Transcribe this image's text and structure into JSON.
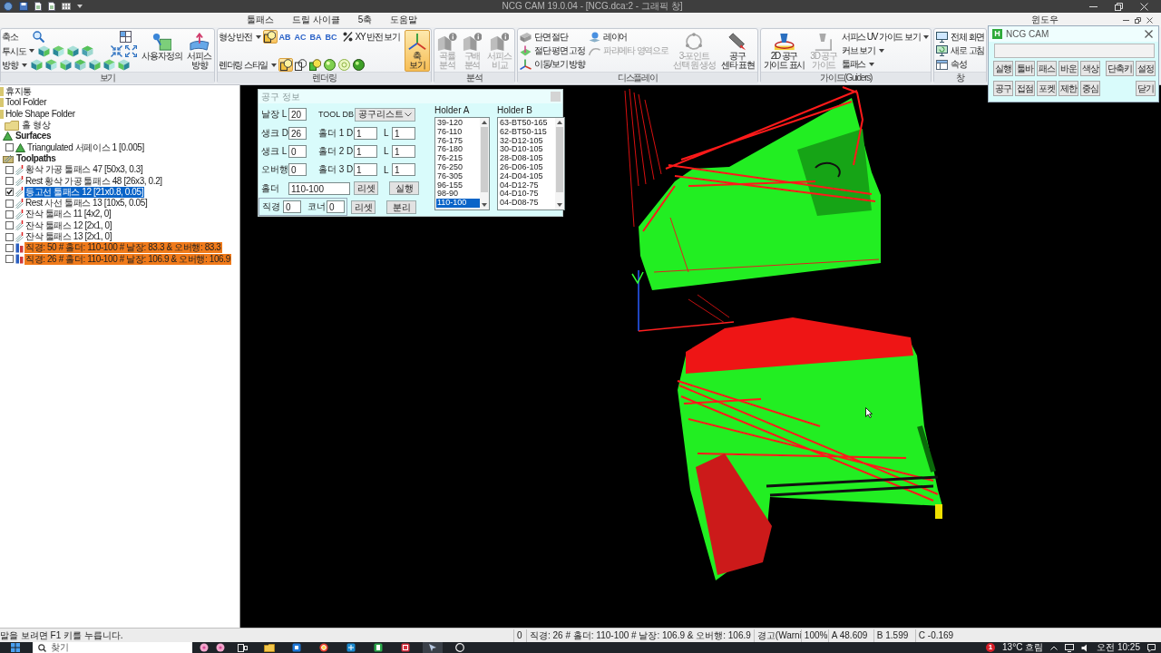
{
  "window": {
    "title": "NCG CAM 19.0.04 - [NCG.dca:2 - 그래픽 창]"
  },
  "menu_tabs": [
    {
      "label": "툴패스",
      "selected": false
    },
    {
      "label": "드릴 사이클",
      "selected": false
    },
    {
      "label": "5축",
      "selected": false
    },
    {
      "label": "도움말",
      "selected": false
    }
  ],
  "window_menu": {
    "label": "윈도우"
  },
  "ribbon": [
    {
      "title": "보기",
      "columns": [
        {
          "kind": "stack",
          "rows": [
            {
              "kind": "field",
              "label": "축소",
              "dropdown": false,
              "buttons": [
                {
                  "kind": "zoom",
                  "selected": false
                },
                {
                  "kind": "grid",
                  "selected": false
                }
              ]
            },
            {
              "kind": "field",
              "label": "투시도",
              "dropdown": true,
              "buttons": [
                {
                  "kind": "cube",
                  "selected": false
                },
                {
                  "kind": "cube",
                  "selected": false
                },
                {
                  "kind": "cube",
                  "selected": false
                },
                {
                  "kind": "cube",
                  "selected": false
                },
                {
                  "kind": "shrink",
                  "selected": false
                },
                {
                  "kind": "expand",
                  "selected": false
                }
              ]
            },
            {
              "kind": "field",
              "label": "방향",
              "dropdown": true,
              "buttons": [
                {
                  "kind": "cube",
                  "selected": false
                },
                {
                  "kind": "cube",
                  "selected": false
                },
                {
                  "kind": "cube",
                  "selected": false
                },
                {
                  "kind": "cube",
                  "selected": false
                },
                {
                  "kind": "cube",
                  "selected": false
                },
                {
                  "kind": "cube",
                  "selected": false
                },
                {
                  "kind": "cube",
                  "selected": false
                }
              ]
            }
          ]
        },
        {
          "kind": "large",
          "label": "사용자정의",
          "disabled": false,
          "on": false
        },
        {
          "kind": "large",
          "label": "서피스\n방향",
          "disabled": false,
          "on": false
        }
      ]
    },
    {
      "title": "렌더링",
      "columns": [
        {
          "kind": "stack",
          "rows": [
            {
              "kind": "field",
              "label": "형상 반전",
              "dropdown": true,
              "buttons": [
                {
                  "kind": "render",
                  "selected": true
                },
                {
                  "kind": "letters",
                  "label": "AB",
                  "selected": false
                },
                {
                  "kind": "letters",
                  "label": "AC",
                  "selected": false
                },
                {
                  "kind": "letters",
                  "label": "BA",
                  "selected": false
                },
                {
                  "kind": "letters",
                  "label": "BC",
                  "selected": false
                },
                {
                  "kind": "command",
                  "label": "XY 반전 보기",
                  "selected": false
                }
              ]
            },
            {
              "kind": "field",
              "label": "렌더링 스타일",
              "dropdown": true,
              "buttons": [
                {
                  "kind": "render",
                  "selected": true
                },
                {
                  "kind": "render",
                  "selected": false
                },
                {
                  "kind": "render",
                  "selected": false
                },
                {
                  "kind": "render",
                  "selected": false
                },
                {
                  "kind": "render",
                  "selected": false
                },
                {
                  "kind": "render",
                  "selected": false
                }
              ]
            }
          ]
        },
        {
          "kind": "large",
          "label": "축\n보기",
          "disabled": false,
          "on": true
        }
      ]
    },
    {
      "title": "분석",
      "columns": [
        {
          "kind": "large",
          "label": "곡률\n분석",
          "disabled": true,
          "on": false
        },
        {
          "kind": "large",
          "label": "구배\n분석",
          "disabled": true,
          "on": false
        },
        {
          "kind": "large",
          "label": "서피스\n비교",
          "disabled": true,
          "on": false
        }
      ]
    },
    {
      "title": "디스플레이",
      "columns": [
        {
          "kind": "stack",
          "rows": [
            {
              "kind": "command",
              "label": "단면 절단",
              "disabled": false
            },
            {
              "kind": "command",
              "label": "절단 평면 고정",
              "disabled": false
            },
            {
              "kind": "command",
              "label": "이동/보기 방향",
              "disabled": false
            }
          ]
        },
        {
          "kind": "stack",
          "rows": [
            {
              "kind": "command",
              "label": "레이어",
              "disabled": false
            },
            {
              "kind": "command",
              "label": "파라메타 영역으로",
              "disabled": true
            }
          ]
        },
        {
          "kind": "large",
          "label": "3-포인트\n선택 원 생성",
          "disabled": true,
          "on": false
        },
        {
          "kind": "large",
          "label": "공구\n센타 표현",
          "disabled": false,
          "on": false
        }
      ]
    },
    {
      "title": "가이드(Guiders)",
      "columns": [
        {
          "kind": "large",
          "label": "2D 공구\n가이드 표시",
          "disabled": false,
          "on": false
        },
        {
          "kind": "large",
          "label": "3D 공구\n가이드",
          "disabled": true,
          "on": false
        },
        {
          "kind": "stack",
          "rows": [
            {
              "kind": "menu",
              "label": "서피스 UV 가이드 보기"
            },
            {
              "kind": "menu",
              "label": "커브 보기"
            },
            {
              "kind": "menu",
              "label": "툴패스"
            }
          ]
        }
      ]
    },
    {
      "title": "창",
      "columns": [
        {
          "kind": "stack",
          "rows": [
            {
              "kind": "command",
              "label": "전체 화면",
              "disabled": false
            },
            {
              "kind": "command",
              "label": "새로 고침",
              "disabled": false
            },
            {
              "kind": "command",
              "label": "속성",
              "disabled": false
            }
          ]
        }
      ]
    }
  ],
  "command_panel": {
    "badge": "H",
    "title": "NCG CAM",
    "rows": [
      {
        "left": [
          "실행",
          "툴바",
          "패스",
          "바운",
          "색상"
        ],
        "right": [
          "단축키",
          "설정"
        ]
      },
      {
        "left": [
          "공구",
          "접점",
          "포켓",
          "제한",
          "중심"
        ],
        "right": [
          "닫기"
        ]
      }
    ]
  },
  "tree": [
    {
      "label": "휴지통",
      "kind": "folder"
    },
    {
      "label": "Tool Folder",
      "kind": "folder"
    },
    {
      "label": "Hole Shape Folder",
      "kind": "folder",
      "children": [
        {
          "label": "홀 형상",
          "kind": "folder"
        }
      ]
    },
    {
      "label": "Surfaces",
      "kind": "surface-group",
      "children": [
        {
          "label": "Triangulated 서페이스 1 [0.005]",
          "kind": "surface",
          "checked": false,
          "selected": false
        }
      ]
    },
    {
      "label": "Toolpaths",
      "kind": "toolpath-group",
      "children": [
        {
          "label": "황삭 가공 툴패스 47 [50x3, 0.3]",
          "kind": "toolpath",
          "checked": false,
          "selected": false
        },
        {
          "label": "Rest 황삭 가공 툴패스 48 [26x3, 0.2]",
          "kind": "toolpath",
          "checked": false,
          "selected": false
        },
        {
          "label": "등고선 툴패스 12 [21x0.8, 0.05]",
          "kind": "toolpath",
          "checked": true,
          "selected": true
        },
        {
          "label": "Rest 사선 툴패스 13 [10x5, 0.05]",
          "kind": "toolpath",
          "checked": false,
          "selected": false
        },
        {
          "label": "잔삭 툴패스 11 [4x2, 0]",
          "kind": "toolpath",
          "checked": false,
          "selected": false
        },
        {
          "label": "잔삭 툴패스 12 [2x1, 0]",
          "kind": "toolpath",
          "checked": false,
          "selected": false
        },
        {
          "label": "잔삭 툴패스 13 [2x1, 0]",
          "kind": "toolpath",
          "checked": false,
          "selected": false
        },
        {
          "label": "직경: 50 # 홀더: 110-100 # 날장: 83.3 & 오버행: 83.3",
          "kind": "tool",
          "checked": false,
          "selected": false
        },
        {
          "label": "직경: 26 # 홀더: 110-100 # 날장: 106.9 & 오버행: 106.9",
          "kind": "tool",
          "checked": false,
          "selected": false
        }
      ]
    }
  ],
  "tool_info": {
    "title": "공구 정보",
    "rows": [
      {
        "label": "날장 L",
        "value": "20"
      },
      {
        "label": "생크 D",
        "value": "26"
      },
      {
        "label": "생크 L",
        "value": "0"
      },
      {
        "label": "오버행",
        "value": "0"
      }
    ],
    "tool_db": {
      "label": "TOOL DB",
      "value": "공구리스트"
    },
    "holder_sizes": [
      {
        "label": "홀더 1 D",
        "d": "1",
        "l_label": "L",
        "l": "1"
      },
      {
        "label": "홀더 2 D",
        "d": "1",
        "l_label": "L",
        "l": "1"
      },
      {
        "label": "홀더 3 D",
        "d": "1",
        "l_label": "L",
        "l": "1"
      }
    ],
    "holder": {
      "label": "홀더",
      "value": "110-100",
      "reset": "리셋",
      "run": "실행"
    },
    "cutter": {
      "diameter_label": "직경",
      "diameter": "0",
      "corner_label": "코너",
      "corner": "0",
      "reset": "리셋",
      "split": "분리"
    },
    "lists": [
      {
        "label": "Holder A",
        "items": [
          {
            "label": "39-120",
            "selected": false
          },
          {
            "label": "76-110",
            "selected": false
          },
          {
            "label": "76-175",
            "selected": false
          },
          {
            "label": "76-180",
            "selected": false
          },
          {
            "label": "76-215",
            "selected": false
          },
          {
            "label": "76-250",
            "selected": false
          },
          {
            "label": "76-305",
            "selected": false
          },
          {
            "label": "96-155",
            "selected": false
          },
          {
            "label": "98-90",
            "selected": false
          },
          {
            "label": "110-100",
            "selected": true
          }
        ]
      },
      {
        "label": "Holder B",
        "items": [
          {
            "label": "63-BT50-165",
            "selected": false
          },
          {
            "label": "62-BT50-115",
            "selected": false
          },
          {
            "label": "32-D12-105",
            "selected": false
          },
          {
            "label": "30-D10-105",
            "selected": false
          },
          {
            "label": "28-D08-105",
            "selected": false
          },
          {
            "label": "26-D06-105",
            "selected": false
          },
          {
            "label": "24-D04-105",
            "selected": false
          },
          {
            "label": "04-D12-75",
            "selected": false
          },
          {
            "label": "04-D10-75",
            "selected": false
          },
          {
            "label": "04-D08-75",
            "selected": false
          }
        ]
      }
    ]
  },
  "status_bar": {
    "help": "말을 보려면 F1 키를 누릅니다.",
    "panes": [
      "0",
      "직경: 26 # 홀더: 110-100 # 날장: 106.9 & 오버행: 106.9",
      "경고(Warni",
      "100%",
      "A 48.609",
      "B 1.599",
      "C -0.169"
    ]
  },
  "taskbar": {
    "search": {
      "placeholder": "찾기"
    },
    "badge": "1",
    "weather": "13°C 흐림",
    "clock": "오전 10:25"
  }
}
